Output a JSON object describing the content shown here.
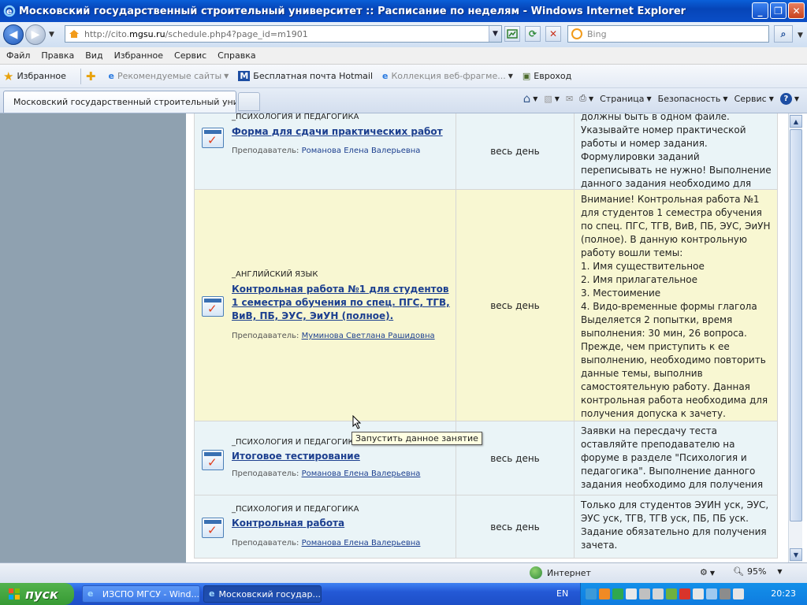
{
  "window": {
    "title": "Московский государственный строительный университет :: Расписание по неделям - Windows Internet Explorer"
  },
  "address": {
    "url_prefix": "http://cito.",
    "url_host": "mgsu.ru",
    "url_path": "/schedule.php4?page_id=m1901",
    "search_placeholder": "Bing"
  },
  "menu": {
    "items": [
      "Файл",
      "Правка",
      "Вид",
      "Избранное",
      "Сервис",
      "Справка"
    ]
  },
  "favorites_bar": {
    "favorites_label": "Избранное",
    "items": [
      "Рекомендуемые сайты",
      "Бесплатная почта Hotmail",
      "Коллекция веб-фрагме...",
      "Евроход"
    ]
  },
  "tabs": {
    "active": "Московский государственный строительный унив..."
  },
  "command_bar": {
    "page": "Страница",
    "safety": "Безопасность",
    "tools": "Сервис"
  },
  "schedule": {
    "rows": [
      {
        "subject": "_ПСИХОЛОГИЯ И ПЕДАГОГИКА",
        "title": "Форма для сдачи практических работ",
        "teacher_label": "Преподаватель:",
        "teacher": "Романова Елена Валерьевна",
        "time": "весь день",
        "note": "должны быть в одном файле. Указывайте номер практической работы и номер задания. Формулировки заданий переписывать не нужно! Выполнение данного задания необходимо для получения зачета."
      },
      {
        "subject": "_АНГЛИЙСКИЙ ЯЗЫК",
        "title": "Контрольная работа №1 для студентов 1 семестра обучения по спец. ПГС, ТГВ, ВиВ, ПБ, ЭУС, ЭиУН (полное).",
        "teacher_label": "Преподаватель:",
        "teacher": "Муминова Светлана Рашидовна",
        "time": "весь день",
        "note": "Внимание! Контрольная работа №1 для студентов 1 семестра обучения по спец. ПГС, ТГВ, ВиВ, ПБ, ЭУС, ЭиУН (полное). В данную контрольную работу вошли темы:\n1. Имя существительное\n2. Имя прилагательное\n3. Местоимение\n4. Видо-временные формы глагола\nВыделяется 2 попытки, время выполнения: 30 мин, 26 вопроса. Прежде, чем приступить к ее выполнению, необходимо повторить данные темы, выполнив самостоятельную работу. Данная контрольная работа необходима для получения допуска к зачету."
      },
      {
        "subject": "_ПСИХОЛОГИЯ И ПЕДАГОГИКА",
        "title": "Итоговое тестирование",
        "teacher_label": "Преподаватель:",
        "teacher": "Романова Елена Валерьевна",
        "time": "весь день",
        "note": "Заявки на пересдачу теста оставляйте преподавателю на форуме в разделе \"Психология и педагогика\". Выполнение данного задания необходимо для получения зачета."
      },
      {
        "subject": "_ПСИХОЛОГИЯ И ПЕДАГОГИКА",
        "title": "Контрольная работа",
        "teacher_label": "Преподаватель:",
        "teacher": "Романова Елена Валерьевна",
        "time": "весь день",
        "note": "Только для студентов ЭУИН уск, ЭУС, ЭУС уск, ТГВ, ТГВ уск, ПБ, ПБ уск. Задание обязательно для получения зачета."
      }
    ]
  },
  "tooltip": "Запустить данное занятие",
  "status_bar": {
    "zone": "Интернет",
    "zoom": "95%"
  },
  "taskbar": {
    "start": "пуск",
    "tasks": [
      "ИЗСПО МГСУ - Wind...",
      "Московский государ..."
    ],
    "lang": "EN",
    "clock": "20:23"
  },
  "colors": {
    "row_blue": "#eaf4f7",
    "row_yellow": "#f8f7d2",
    "link": "#1c3f8f",
    "left_panel": "#8fa1b0"
  }
}
